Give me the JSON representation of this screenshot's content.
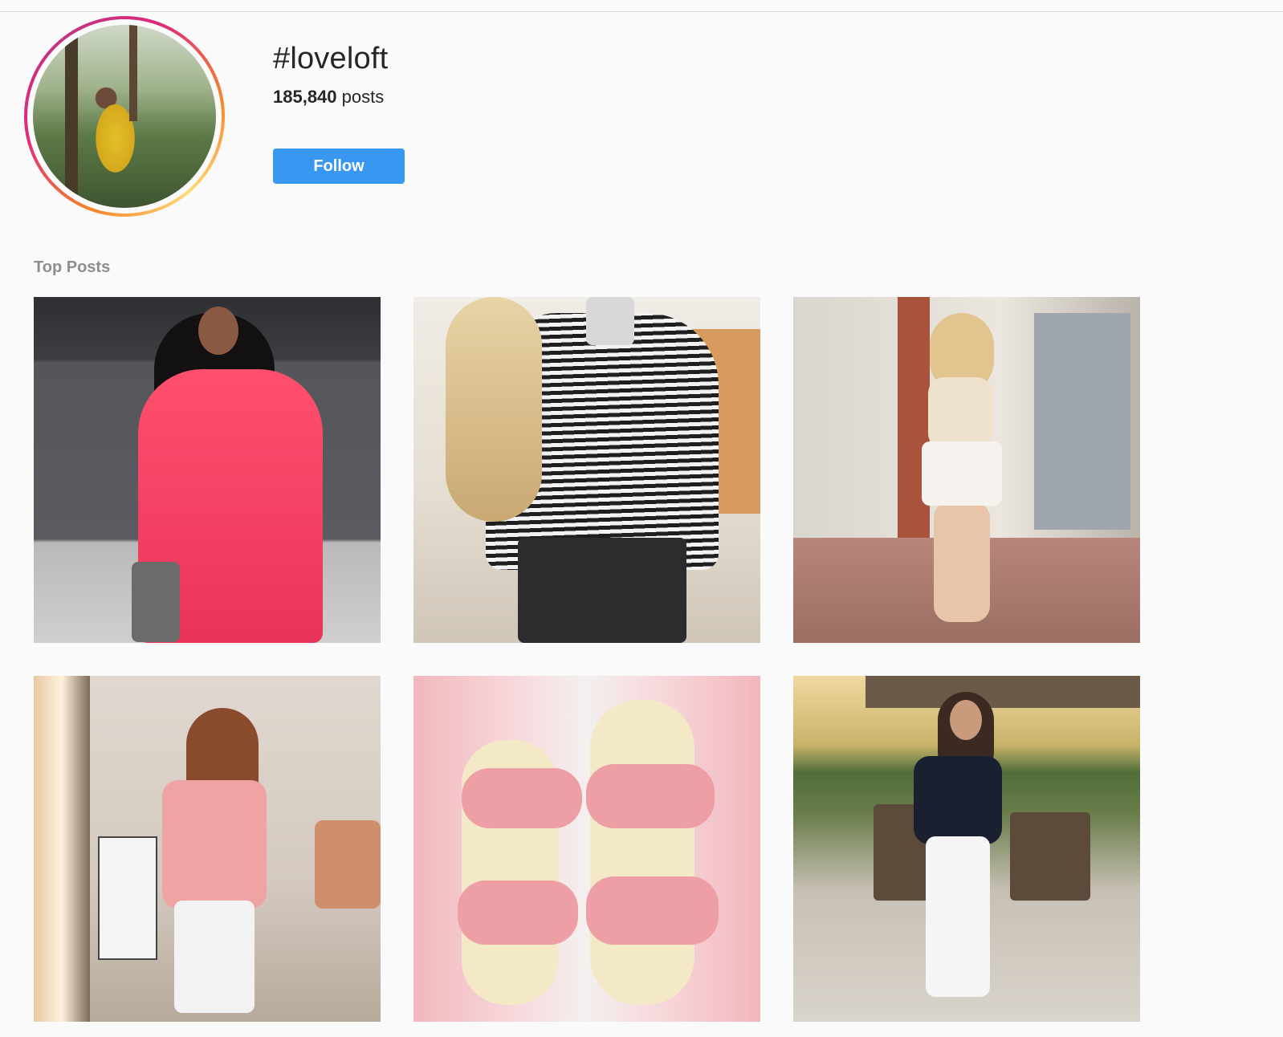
{
  "hashtag": {
    "title": "#loveloft",
    "post_count": "185,840",
    "post_count_suffix": " posts",
    "follow_label": "Follow"
  },
  "top_posts": {
    "title": "Top Posts",
    "tiles": [
      {
        "subject": "woman in pink tiered dress by brick wall"
      },
      {
        "subject": "mirror selfie in black and white striped top"
      },
      {
        "subject": "woman in cream top and white shorts on street"
      },
      {
        "subject": "mirror selfie in pink cardigan and white jeans"
      },
      {
        "subject": "pink bow slide sandals held up"
      },
      {
        "subject": "woman in black tee and white jeans on patio"
      }
    ]
  },
  "colors": {
    "follow_button": "#3897f0",
    "background": "#fafafa",
    "section_title": "#8e8e8e"
  }
}
